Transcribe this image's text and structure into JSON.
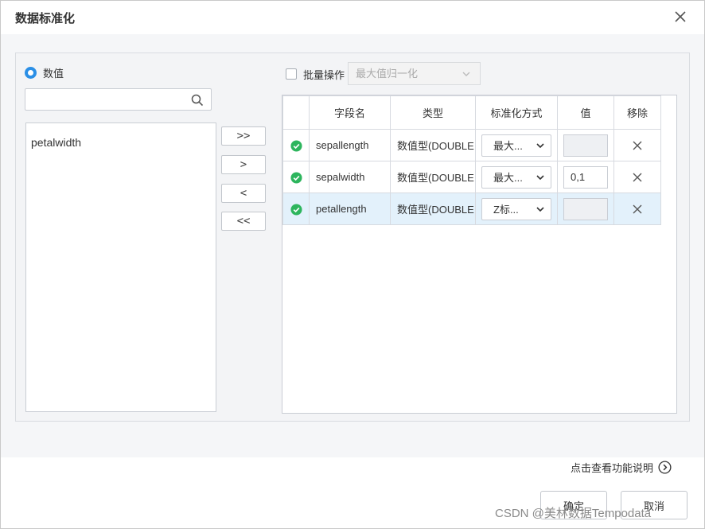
{
  "dialog": {
    "title": "数据标准化"
  },
  "left": {
    "radio_label": "数值",
    "search": {
      "value": "",
      "placeholder": ""
    },
    "fields": [
      "petalwidth"
    ]
  },
  "move_buttons": [
    {
      "label": ">>"
    },
    {
      "label": ">"
    },
    {
      "label": "<"
    },
    {
      "label": "<<"
    }
  ],
  "batch": {
    "label": "批量操作",
    "select_value": "最大值归一化"
  },
  "table": {
    "headers": [
      "",
      "字段名",
      "类型",
      "标准化方式",
      "值",
      "移除"
    ],
    "rows": [
      {
        "name": "sepallength",
        "type": "数值型(DOUBLE",
        "method": "最大...",
        "value": "",
        "selected": false
      },
      {
        "name": "sepalwidth",
        "type": "数值型(DOUBLE",
        "method": "最大...",
        "value": "0,1",
        "selected": false
      },
      {
        "name": "petallength",
        "type": "数值型(DOUBLE",
        "method": "Z标...",
        "value": "",
        "selected": true
      }
    ]
  },
  "help_text": "点击查看功能说明",
  "footer": {
    "ok_label": "确定",
    "cancel_label": "取消"
  },
  "watermark": "CSDN @美林数据Tempodata",
  "colors": {
    "accent": "#2b8fe6",
    "ok_green": "#2db55d",
    "selected_row": "#e3f1fb"
  }
}
